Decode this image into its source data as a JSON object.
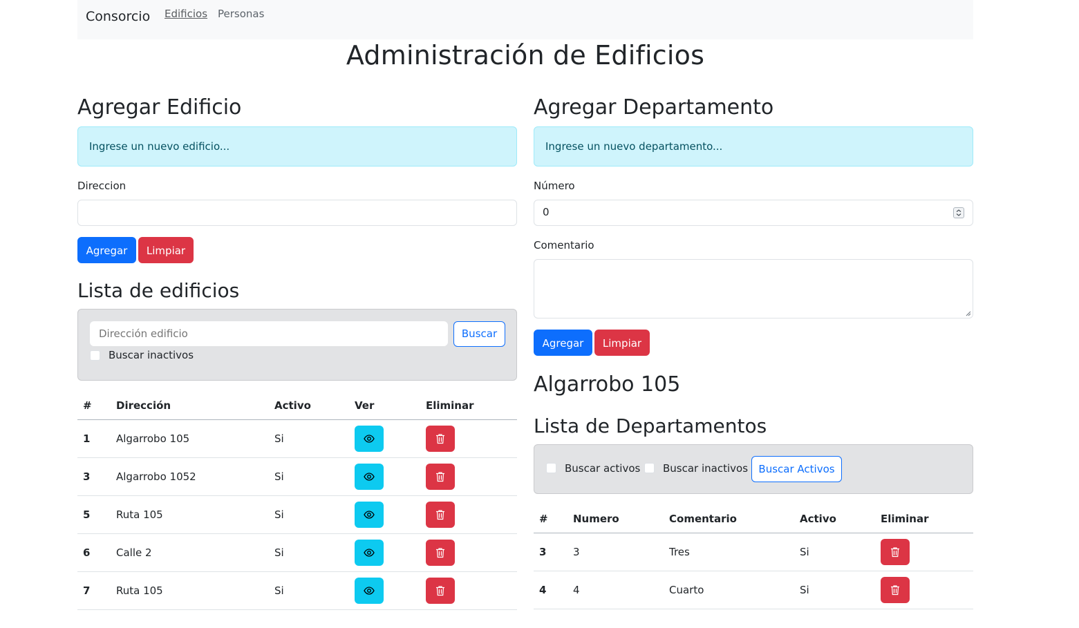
{
  "nav": {
    "brand": "Consorcio",
    "links": [
      "Edificios",
      "Personas"
    ]
  },
  "page_title": "Administración de Edificios",
  "add_building": {
    "title": "Agregar Edificio",
    "alert": "Ingrese un nuevo edificio...",
    "address_label": "Direccion",
    "address_value": "",
    "add_label": "Agregar",
    "clear_label": "Limpiar"
  },
  "building_list": {
    "title": "Lista de edificios",
    "search_placeholder": "Dirección edificio",
    "search_label": "Buscar",
    "inactive_label": "Buscar inactivos",
    "headers": [
      "#",
      "Dirección",
      "Activo",
      "Ver",
      "Eliminar"
    ],
    "rows": [
      {
        "id": "1",
        "address": "Algarrobo 105",
        "active": "Si"
      },
      {
        "id": "3",
        "address": "Algarrobo 1052",
        "active": "Si"
      },
      {
        "id": "5",
        "address": "Ruta 105",
        "active": "Si"
      },
      {
        "id": "6",
        "address": "Calle 2",
        "active": "Si"
      },
      {
        "id": "7",
        "address": "Ruta 105",
        "active": "Si"
      }
    ]
  },
  "add_department": {
    "title": "Agregar Departamento",
    "alert": "Ingrese un nuevo departamento...",
    "number_label": "Número",
    "number_value": "0",
    "comment_label": "Comentario",
    "comment_value": "",
    "add_label": "Agregar",
    "clear_label": "Limpiar"
  },
  "selected_building": "Algarrobo 105",
  "department_list": {
    "title": "Lista de Departamentos",
    "active_label": "Buscar activos",
    "inactive_label": "Buscar inactivos",
    "search_label": "Buscar Activos",
    "headers": [
      "#",
      "Numero",
      "Comentario",
      "Activo",
      "Eliminar"
    ],
    "rows": [
      {
        "id": "3",
        "number": "3",
        "comment": "Tres",
        "active": "Si"
      },
      {
        "id": "4",
        "number": "4",
        "comment": "Cuarto",
        "active": "Si"
      }
    ]
  },
  "colors": {
    "primary": "#0d6efd",
    "danger": "#dc3545",
    "info": "#0dcaf0",
    "alert_bg": "#cff4fc"
  },
  "icons": {
    "view": "eye-icon",
    "delete": "trash-icon"
  }
}
